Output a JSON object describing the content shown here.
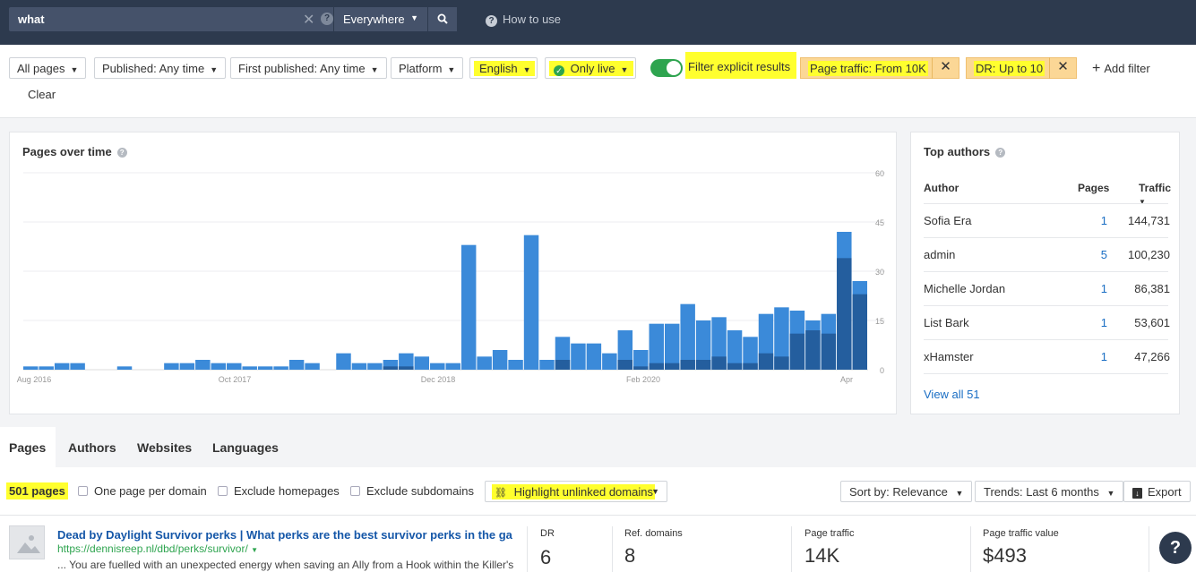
{
  "search": {
    "query": "what",
    "scope": "Everywhere",
    "how_to_use": "How to use"
  },
  "filters": {
    "all_pages": "All pages",
    "published": "Published: Any time",
    "first_published": "First published: Any time",
    "platform": "Platform",
    "language": "English",
    "live": "Only live",
    "explicit": "Filter explicit results",
    "page_traffic": "Page traffic: From 10K",
    "dr": "DR: Up to 10",
    "add_filter": "Add filter",
    "clear": "Clear"
  },
  "chart_data": {
    "type": "bar",
    "title": "Pages over time",
    "x_tick_labels": [
      "Aug 2016",
      "Oct 2017",
      "Dec 2018",
      "Feb 2020",
      "Apr"
    ],
    "y_ticks": [
      0,
      15,
      30,
      45,
      60
    ],
    "ylim": [
      0,
      60
    ],
    "series": [
      {
        "values": [
          1,
          1,
          2,
          2,
          0,
          0,
          1,
          0,
          0,
          2,
          2,
          3,
          2,
          2,
          1,
          1,
          1,
          3,
          2,
          0,
          5,
          2,
          2,
          3,
          5,
          4,
          2,
          2,
          38,
          4,
          6,
          3,
          41,
          3,
          10,
          8,
          8,
          5,
          12,
          6,
          14,
          14,
          20,
          15,
          16,
          12,
          10,
          17,
          19,
          18,
          15,
          17,
          42,
          27
        ]
      },
      {
        "values": [
          0,
          0,
          0,
          0,
          0,
          0,
          0,
          0,
          0,
          0,
          0,
          0,
          0,
          0,
          0,
          0,
          0,
          0,
          0,
          0,
          0,
          0,
          0,
          1,
          1,
          0,
          0,
          0,
          0,
          0,
          0,
          0,
          0,
          0,
          3,
          0,
          0,
          0,
          3,
          1,
          2,
          2,
          3,
          3,
          4,
          2,
          2,
          5,
          4,
          11,
          12,
          11,
          34,
          23
        ]
      }
    ],
    "colors": [
      "#3b8ad9",
      "#245e9e"
    ]
  },
  "authors": {
    "title": "Top authors",
    "col_author": "Author",
    "col_pages": "Pages",
    "col_traffic": "Traffic",
    "rows": [
      {
        "author": "Sofia Era",
        "pages": "1",
        "traffic": "144,731"
      },
      {
        "author": "admin",
        "pages": "5",
        "traffic": "100,230"
      },
      {
        "author": "Michelle Jordan",
        "pages": "1",
        "traffic": "86,381"
      },
      {
        "author": "List Bark",
        "pages": "1",
        "traffic": "53,601"
      },
      {
        "author": "xHamster",
        "pages": "1",
        "traffic": "47,266"
      }
    ],
    "view_all": "View all 51"
  },
  "tabs": [
    "Pages",
    "Authors",
    "Websites",
    "Languages"
  ],
  "toolbar": {
    "count": "501 pages",
    "one_per_domain": "One page per domain",
    "exclude_home": "Exclude homepages",
    "exclude_sub": "Exclude subdomains",
    "highlight": "Highlight unlinked domains",
    "sort": "Sort by: Relevance",
    "trends": "Trends: Last 6 months",
    "export": "Export"
  },
  "result": {
    "title": "Dead by Daylight Survivor perks | What perks are the best survivor perks in the ga",
    "url": "https://dennisreep.nl/dbd/perks/survivor/",
    "snippet": "... You are fuelled with an unexpected energy when saving an Ally from a Hook within the Killer's",
    "dr_label": "DR",
    "dr": "6",
    "ref_label": "Ref. domains",
    "ref": "8",
    "traffic_label": "Page traffic",
    "traffic": "14K",
    "value_label": "Page traffic value",
    "value": "$493"
  },
  "help": "?"
}
